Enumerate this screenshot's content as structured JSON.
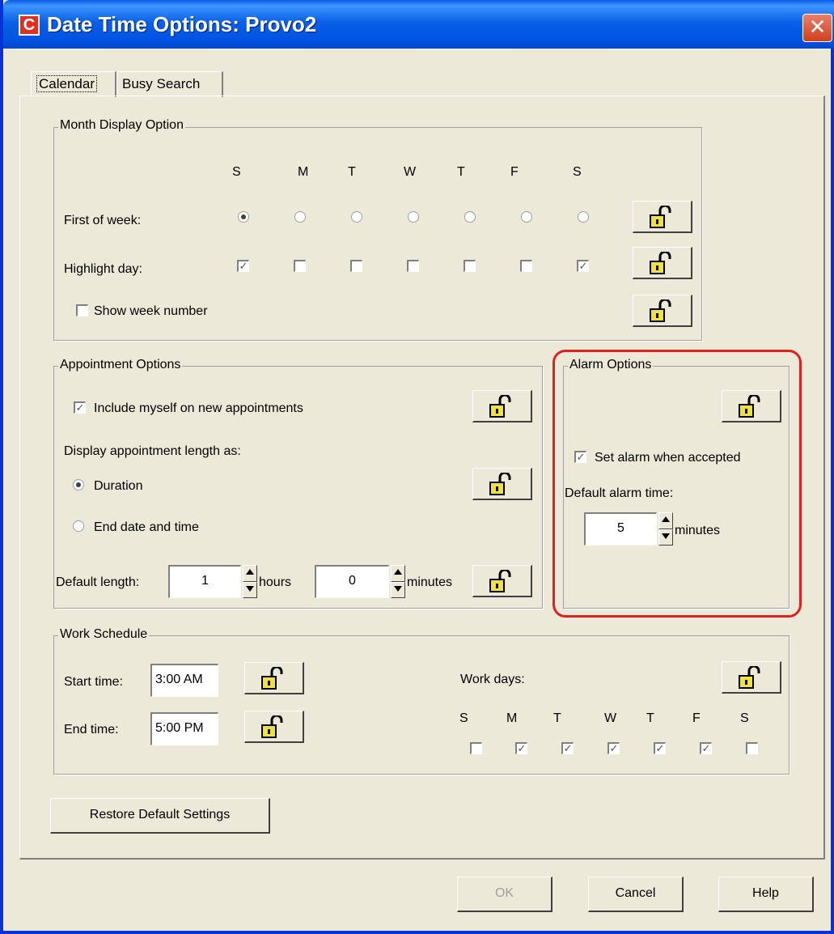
{
  "window": {
    "title": "Date Time Options:  Provo2",
    "app_icon_letter": "C",
    "close_symbol": "✕"
  },
  "tabs": [
    {
      "label": "Calendar",
      "active": true
    },
    {
      "label": "Busy Search",
      "active": false
    }
  ],
  "month_display": {
    "legend": "Month Display Option",
    "day_headers": [
      "S",
      "M",
      "T",
      "W",
      "T",
      "F",
      "S"
    ],
    "first_of_week_label": "First of week:",
    "first_of_week_selected": "S",
    "highlight_day_label": "Highlight day:",
    "highlight_days_checked": [
      true,
      false,
      false,
      false,
      false,
      false,
      true
    ],
    "show_week_number_label": "Show week number",
    "show_week_number_checked": false
  },
  "appointment": {
    "legend": "Appointment Options",
    "include_myself_label": "Include myself on new appointments",
    "include_myself_checked": true,
    "display_length_label": "Display appointment length as:",
    "duration_label": "Duration",
    "end_date_label": "End date and time",
    "selected": "Duration",
    "default_length_label": "Default length:",
    "hours_value": "1",
    "hours_unit": "hours",
    "minutes_value": "0",
    "minutes_unit": "minutes"
  },
  "alarm": {
    "legend": "Alarm Options",
    "set_alarm_label": "Set alarm when accepted",
    "set_alarm_checked": true,
    "default_time_label": "Default alarm time:",
    "minutes_value": "5",
    "minutes_unit": "minutes"
  },
  "work_schedule": {
    "legend": "Work Schedule",
    "start_label": "Start time:",
    "start_value": "3:00 AM",
    "end_label": "End time:",
    "end_value": "5:00 PM",
    "work_days_label": "Work days:",
    "day_headers": [
      "S",
      "M",
      "T",
      "W",
      "T",
      "F",
      "S"
    ],
    "days_checked": [
      false,
      true,
      true,
      true,
      true,
      true,
      false
    ]
  },
  "restore_button_label": "Restore Default Settings",
  "footer": {
    "ok_label": "OK",
    "cancel_label": "Cancel",
    "help_label": "Help"
  },
  "icons": {
    "lock": "open-padlock-icon",
    "check_mark": "✓"
  },
  "colors": {
    "title_bar": "#0054e3",
    "face": "#ece9d8",
    "highlight_ring": "#e02020",
    "lock_yellow": "#f0e040"
  }
}
